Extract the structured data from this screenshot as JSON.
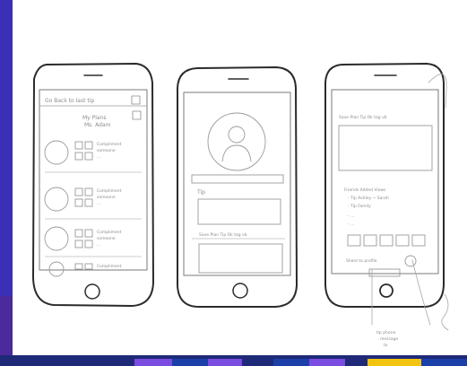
{
  "page": {
    "frame_color_left": "#3a2fb5",
    "frame_color_bottom": "#1e2a78",
    "stripe_colors": [
      "#7b4ce0",
      "#1b3fa8",
      "#7b4ce0",
      "#1b3fa8",
      "#7b4ce0",
      "#f2c40f",
      "#1b3fa8"
    ]
  },
  "phone1": {
    "header_text": "Go Back to last tip",
    "title_text": "My Plans",
    "subtitle_text": "Ms. Adam",
    "list_items": [
      {
        "line1": "Compliment",
        "line2": "someone",
        "line3": "..."
      },
      {
        "line1": "Compliment",
        "line2": "someone",
        "line3": "..."
      },
      {
        "line1": "Compliment",
        "line2": "someone",
        "line3": "..."
      },
      {
        "line1": "Compliment",
        "line2": "someone",
        "line3": "..."
      }
    ]
  },
  "phone2": {
    "label_top": "Tip",
    "header_bottom": "Save Plan  Tip  Ok  tag  vb"
  },
  "phone3": {
    "header_text": "Save Plan  Tip  Ok  tag  vb",
    "section_title": "Friends  Added  Views",
    "bullets": [
      "- Tip  Ashley ~ Sarah",
      "- Tip  Family",
      "- ...",
      "- ..."
    ],
    "footer_label": "Share to profile",
    "button_label": ""
  },
  "annotation": {
    "line1": "tip  phone",
    "line2": "message",
    "line3": "to"
  }
}
